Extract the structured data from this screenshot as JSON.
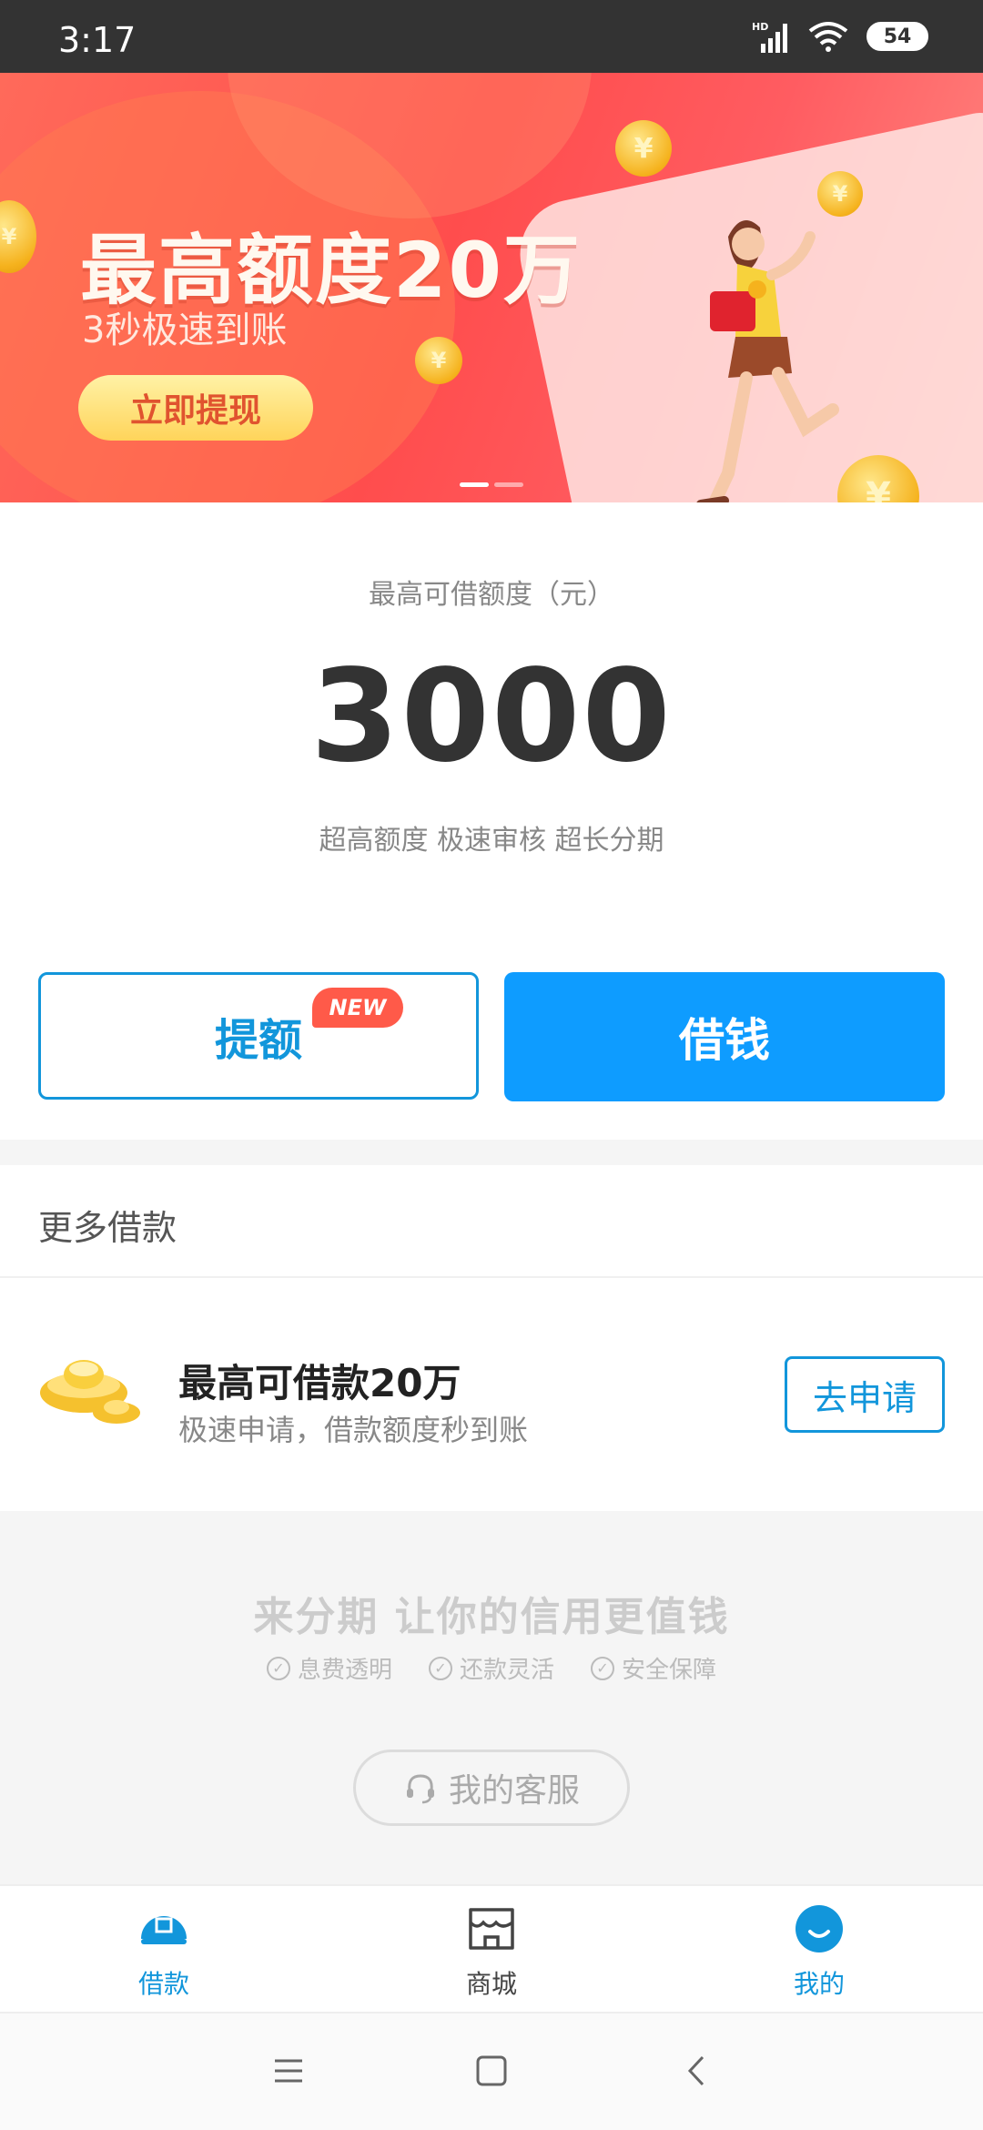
{
  "status_bar": {
    "time": "3:17",
    "battery": "54",
    "network": "HD"
  },
  "banner": {
    "title": "最高额度20万",
    "subtitle": "3秒极速到账",
    "button_label": "立即提现",
    "coin_symbol": "¥",
    "slide_count": 2,
    "active_slide": 1
  },
  "limit": {
    "label": "最高可借额度（元）",
    "amount": "3000",
    "tagline": "超高额度 极速审核 超长分期"
  },
  "actions": {
    "raise_label": "提额",
    "raise_badge": "NEW",
    "borrow_label": "借钱"
  },
  "more_loans": {
    "title": "更多借款",
    "offer_title": "最高可借款20万",
    "offer_subtitle": "极速申请，借款额度秒到账",
    "apply_label": "去申请"
  },
  "footer": {
    "slogan": "来分期 让你的信用更值钱",
    "features": [
      "息费透明",
      "还款灵活",
      "安全保障"
    ],
    "service_label": "我的客服"
  },
  "tabs": [
    {
      "label": "借款",
      "icon": "loan-icon",
      "active": true
    },
    {
      "label": "商城",
      "icon": "store-icon",
      "active": false
    },
    {
      "label": "我的",
      "icon": "profile-icon",
      "active": false
    }
  ],
  "colors": {
    "primary": "#0e9cff",
    "accent_blue": "#1296db",
    "badge_red": "#ff5a49",
    "banner_red": "#ff4d4d",
    "status_bar": "#333333"
  }
}
